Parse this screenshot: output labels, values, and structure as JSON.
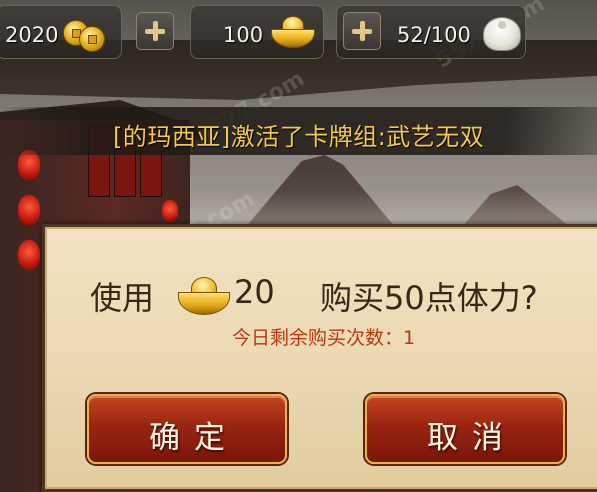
{
  "topbar": {
    "coins_value": "2020",
    "gold_value": "100",
    "stamina_value": "52/100",
    "icons": {
      "coins": "copper-coins-icon",
      "gold": "gold-ingot-icon",
      "stamina": "steamed-bun-icon",
      "add": "plus-icon"
    }
  },
  "notice": {
    "message": "[的玛西亚]激活了卡牌组:武艺无双"
  },
  "dialog": {
    "question_prefix": "使用",
    "cost": "20",
    "question_suffix": "购买50点体力?",
    "remaining_label": "今日剩余购买次数：1",
    "confirm_label": "确定",
    "cancel_label": "取消"
  },
  "watermark": {
    "text": "5577.com"
  },
  "colors": {
    "notice_text": "#f3c84c",
    "remaining_text": "#b53a10",
    "button_red": "#9a2512",
    "button_border": "#e8b44a",
    "dialog_bg": "#eddcb8"
  }
}
